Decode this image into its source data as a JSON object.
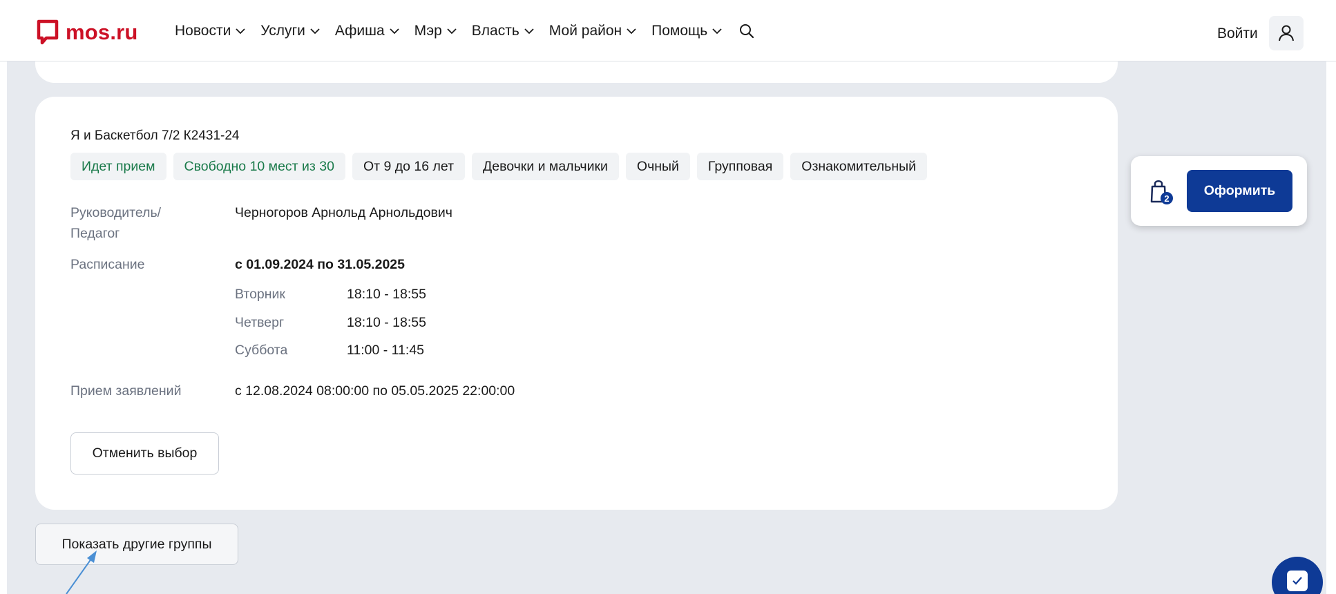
{
  "header": {
    "logo_text": "mos.ru",
    "nav": [
      {
        "label": "Новости"
      },
      {
        "label": "Услуги"
      },
      {
        "label": "Афиша"
      },
      {
        "label": "Мэр"
      },
      {
        "label": "Власть"
      },
      {
        "label": "Мой район"
      },
      {
        "label": "Помощь"
      }
    ],
    "login_label": "Войти"
  },
  "group": {
    "title": "Я и Баскетбол 7/2 К2431-24",
    "tags": [
      {
        "label": "Идет прием",
        "status": "green"
      },
      {
        "label": "Свободно 10 мест из 30",
        "status": "green"
      },
      {
        "label": "От 9 до 16 лет"
      },
      {
        "label": "Девочки и мальчики"
      },
      {
        "label": "Очный"
      },
      {
        "label": "Групповая"
      },
      {
        "label": "Ознакомительный"
      }
    ],
    "teacher_label_line1": "Руководитель/",
    "teacher_label_line2": "Педагог",
    "teacher_value": "Черногоров Арнольд Арнольдович",
    "schedule_label": "Расписание",
    "schedule_period": "с 01.09.2024 по 31.05.2025",
    "schedule": [
      {
        "day": "Вторник",
        "time": "18:10 - 18:55"
      },
      {
        "day": "Четверг",
        "time": "18:10 - 18:55"
      },
      {
        "day": "Суббота",
        "time": "11:00 - 11:45"
      }
    ],
    "applications_label": "Прием заявлений",
    "applications_value": "с 12.08.2024 08:00:00 по 05.05.2025 22:00:00",
    "cancel_label": "Отменить выбор"
  },
  "show_other_label": "Показать другие группы",
  "cart": {
    "count": "2",
    "order_label": "Оформить"
  },
  "colors": {
    "accent": "#0e3a96",
    "brand": "#cc1126",
    "status_green": "#1a7a4a"
  }
}
